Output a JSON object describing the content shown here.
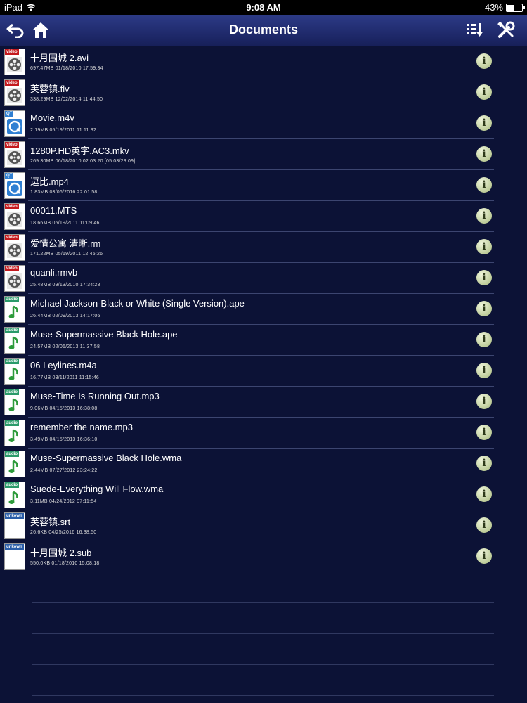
{
  "status_bar": {
    "device": "iPad",
    "time": "9:08 AM",
    "battery": "43%"
  },
  "nav": {
    "title": "Documents"
  },
  "icons": {
    "back": "back-arrow-icon",
    "home": "home-icon",
    "sort": "sort-download-icon",
    "tools": "tools-icon",
    "info": "info-icon"
  },
  "files": [
    {
      "name": "十月围城 2.avi",
      "meta": "697.47MB   01/18/2010 17:59:34",
      "type": "video",
      "tag": "video"
    },
    {
      "name": "芙蓉镇.flv",
      "meta": "338.29MB   12/02/2014 11:44:50",
      "type": "video",
      "tag": "video"
    },
    {
      "name": "Movie.m4v",
      "meta": "2.19MB   05/19/2011 11:11:32",
      "type": "qt",
      "tag": "QT"
    },
    {
      "name": "1280P.HD英字.AC3.mkv",
      "meta": "269.30MB   06/18/2010 02:03:20  [05:03/23:09]",
      "type": "video",
      "tag": "video"
    },
    {
      "name": "逗比.mp4",
      "meta": "1.83MB   03/06/2016 22:01:58",
      "type": "qt",
      "tag": "QT"
    },
    {
      "name": "00011.MTS",
      "meta": "18.66MB   05/19/2011 11:09:46",
      "type": "video",
      "tag": "video"
    },
    {
      "name": "爱情公寓 清晰.rm",
      "meta": "171.22MB   05/19/2011 12:45:26",
      "type": "video",
      "tag": "video"
    },
    {
      "name": "quanli.rmvb",
      "meta": "25.48MB   09/13/2010 17:34:28",
      "type": "video",
      "tag": "video"
    },
    {
      "name": "Michael Jackson-Black or White (Single Version).ape",
      "meta": "26.44MB   02/09/2013 14:17:06",
      "type": "audio",
      "tag": "audio"
    },
    {
      "name": "Muse-Supermassive Black Hole.ape",
      "meta": "24.57MB   02/06/2013 11:37:58",
      "type": "audio",
      "tag": "audio"
    },
    {
      "name": "06 Leylines.m4a",
      "meta": "16.77MB   03/11/2011 11:15:46",
      "type": "audio",
      "tag": "audio"
    },
    {
      "name": "Muse-Time Is Running Out.mp3",
      "meta": "9.06MB   04/15/2013 16:38:08",
      "type": "audio",
      "tag": "audio"
    },
    {
      "name": "remember the name.mp3",
      "meta": "3.49MB   04/15/2013 16:36:10",
      "type": "audio",
      "tag": "audio"
    },
    {
      "name": "Muse-Supermassive Black Hole.wma",
      "meta": "2.44MB   07/27/2012 23:24:22",
      "type": "audio",
      "tag": "audio"
    },
    {
      "name": "Suede-Everything Will Flow.wma",
      "meta": "3.11MB   04/24/2012 07:11:54",
      "type": "audio",
      "tag": "audio"
    },
    {
      "name": "芙蓉镇.srt",
      "meta": "26.6KB   04/25/2016 16:38:50",
      "type": "unknown",
      "tag": "unkown"
    },
    {
      "name": "十月围城 2.sub",
      "meta": "550.0KB   01/18/2010 15:08:18",
      "type": "unknown",
      "tag": "unkown"
    }
  ],
  "colors": {
    "background": "#0c1236",
    "video_tag": "#c4191d",
    "audio_tag": "#2a9a6a",
    "qt_tag": "#2f7fd2",
    "unknown_tag": "#2a5da8"
  }
}
